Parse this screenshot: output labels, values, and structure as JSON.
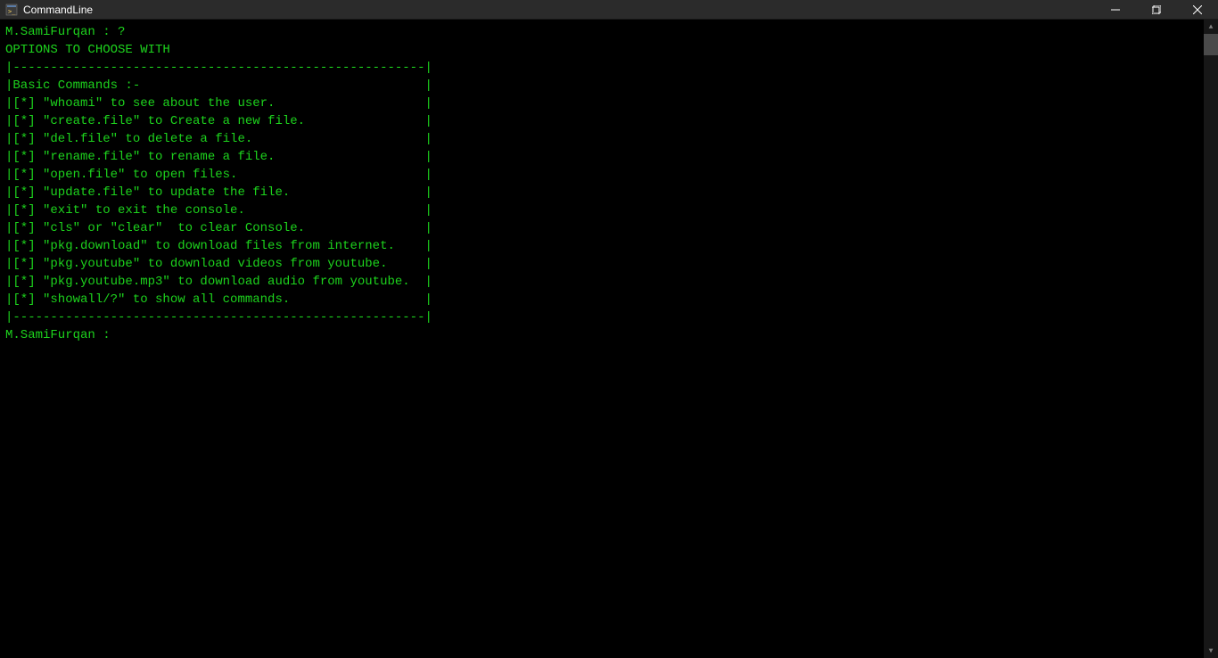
{
  "window": {
    "title": "CommandLine"
  },
  "terminal": {
    "prompt_line": "M.SamiFurqan : ?",
    "header": "OPTIONS TO CHOOSE WITH",
    "border_top": "|-------------------------------------------------------|",
    "section_title": "|Basic Commands :-                                      |",
    "commands": [
      "|[*] \"whoami\" to see about the user.                    |",
      "|[*] \"create.file\" to Create a new file.                |",
      "|[*] \"del.file\" to delete a file.                       |",
      "|[*] \"rename.file\" to rename a file.                    |",
      "|[*] \"open.file\" to open files.                         |",
      "|[*] \"update.file\" to update the file.                  |",
      "|[*] \"exit\" to exit the console.                        |",
      "|[*] \"cls\" or \"clear\"  to clear Console.                |",
      "|[*] \"pkg.download\" to download files from internet.    |",
      "|[*] \"pkg.youtube\" to download videos from youtube.     |",
      "|[*] \"pkg.youtube.mp3\" to download audio from youtube.  |",
      "|[*] \"showall/?\" to show all commands.                  |"
    ],
    "border_bottom": "|-------------------------------------------------------|",
    "current_prompt": "M.SamiFurqan : "
  }
}
